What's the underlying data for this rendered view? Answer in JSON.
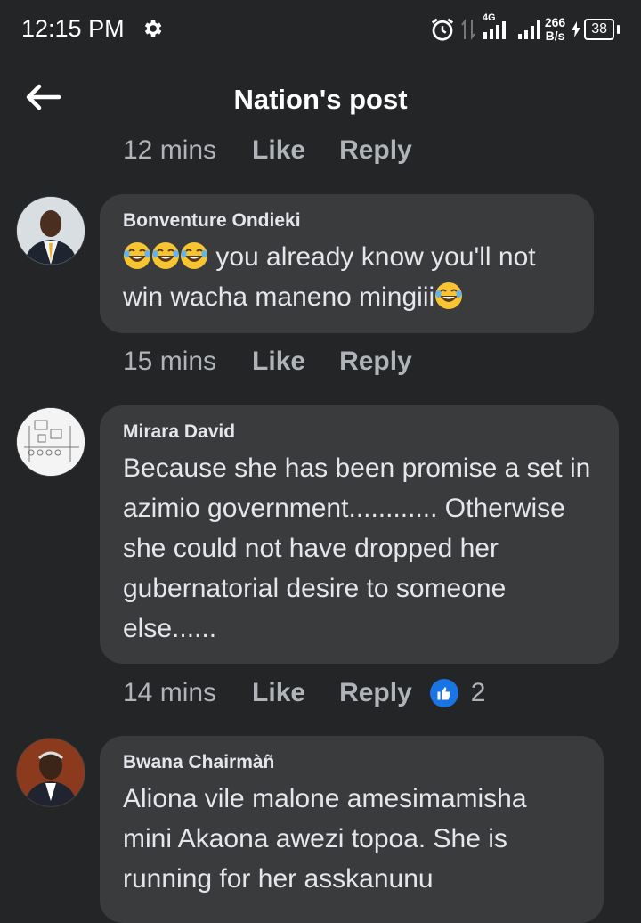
{
  "status_bar": {
    "time": "12:15 PM",
    "network_type": "4G",
    "speed_value": "266",
    "speed_unit": "B/s",
    "battery": "38",
    "icons": [
      "gear-icon",
      "alarm-icon",
      "data-arrows-icon",
      "signal-icon",
      "charging-icon"
    ]
  },
  "header": {
    "title": "Nation's post",
    "back_icon": "arrow-left-icon"
  },
  "top_meta": {
    "time": "12 mins",
    "like": "Like",
    "reply": "Reply"
  },
  "comments": [
    {
      "author": "Bonventure Ondieki",
      "text_part1": " you already know you'll not win wacha maneno mingiii",
      "emoji": "rolling-on-floor-laughing",
      "meta": {
        "time": "15 mins",
        "like": "Like",
        "reply": "Reply"
      }
    },
    {
      "author": "Mirara David",
      "text": "Because she has been promise a set in azimio government............ Otherwise she could not have dropped her gubernatorial desire to someone else......",
      "meta": {
        "time": "14 mins",
        "like": "Like",
        "reply": "Reply",
        "reaction_count": "2",
        "reaction_icon": "thumbs-up-icon"
      }
    },
    {
      "author": "Bwana Chairmàñ",
      "text": "Aliona vile malone amesimamisha mini Akaona awezi topoa. She is running for her asskanunu"
    }
  ],
  "colors": {
    "background": "#242526",
    "bubble": "#3a3b3c",
    "meta_text": "#b0b3b8",
    "like_blue": "#1b74e4",
    "emoji_yellow": "#f7c533"
  }
}
